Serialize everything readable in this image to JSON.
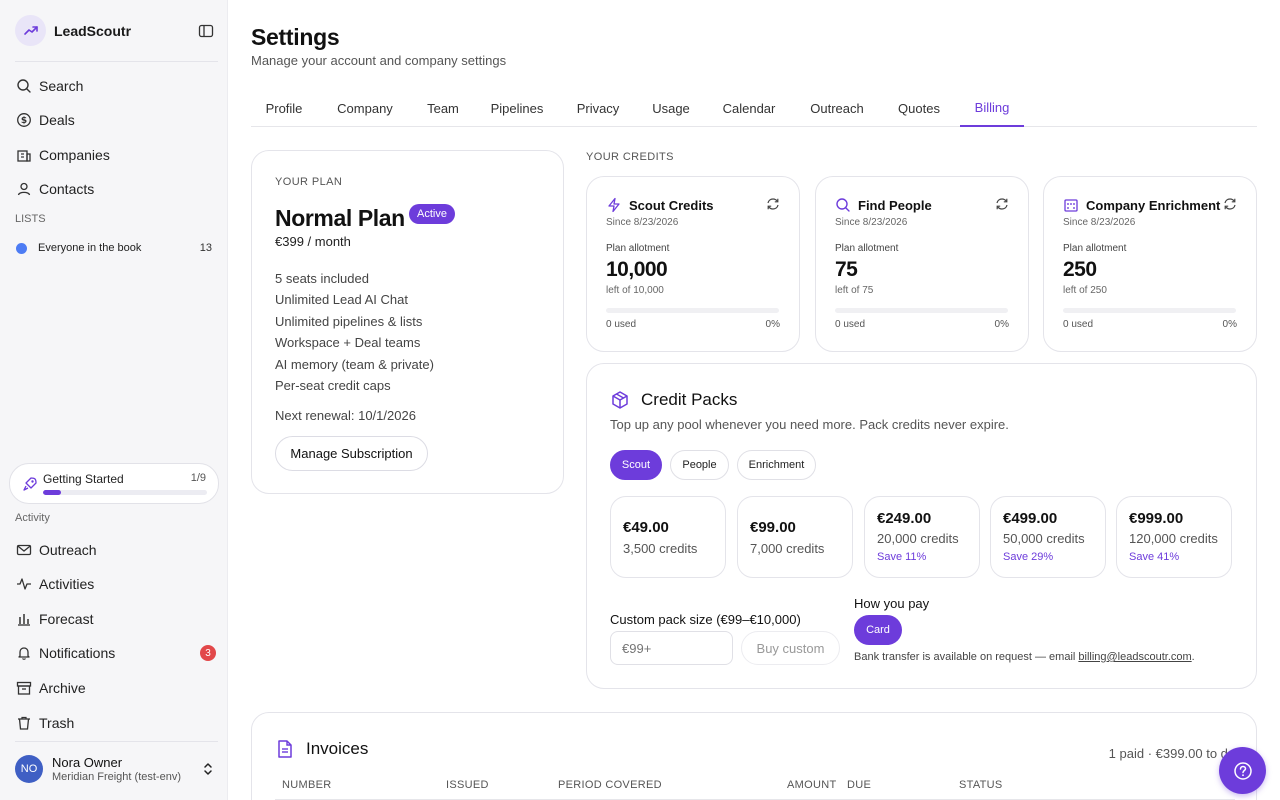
{
  "app": {
    "name": "LeadScoutr"
  },
  "sidebar": {
    "nav": [
      {
        "label": "Search",
        "icon": "search-icon"
      },
      {
        "label": "Deals",
        "icon": "dollar-icon"
      },
      {
        "label": "Companies",
        "icon": "building-icon"
      },
      {
        "label": "Contacts",
        "icon": "user-icon"
      }
    ],
    "lists_label": "LISTS",
    "lists": [
      {
        "label": "Everyone in the book",
        "count": "13",
        "color": "#4d7cf4"
      }
    ],
    "getting_started": {
      "label": "Getting Started",
      "count": "1/9",
      "progress": 0.11
    },
    "activity_label": "Activity",
    "activity": [
      {
        "label": "Outreach",
        "icon": "mail-icon"
      },
      {
        "label": "Activities",
        "icon": "pulse-icon"
      },
      {
        "label": "Forecast",
        "icon": "bar-chart-icon"
      },
      {
        "label": "Notifications",
        "icon": "bell-icon",
        "badge": "3"
      },
      {
        "label": "Archive",
        "icon": "archive-icon"
      },
      {
        "label": "Trash",
        "icon": "trash-icon"
      }
    ],
    "user": {
      "initials": "NO",
      "name": "Nora Owner",
      "org": "Meridian Freight (test-env)"
    }
  },
  "page": {
    "title": "Settings",
    "subtitle": "Manage your account and company settings"
  },
  "tabs": [
    "Profile",
    "Company",
    "Team",
    "Pipelines",
    "Privacy",
    "Usage",
    "Calendar",
    "Outreach",
    "Quotes",
    "Billing"
  ],
  "active_tab": "Billing",
  "plan": {
    "caption": "YOUR PLAN",
    "name": "Normal Plan",
    "badge": "Active",
    "price": "€399 / month",
    "features": [
      "5 seats included",
      "Unlimited Lead AI Chat",
      "Unlimited pipelines & lists",
      "Workspace + Deal teams",
      "AI memory (team & private)",
      "Per-seat credit caps"
    ],
    "renewal": "Next renewal: 10/1/2026",
    "manage_label": "Manage Subscription"
  },
  "credits": {
    "caption": "YOUR CREDITS",
    "cards": [
      {
        "title": "Scout Credits",
        "icon": "bolt-icon",
        "since": "Since 8/23/2026",
        "allot_label": "Plan allotment",
        "value": "10,000",
        "left": "left of 10,000",
        "used": "0 used",
        "pct": "0%",
        "fill": 0
      },
      {
        "title": "Find People",
        "icon": "search-icon",
        "since": "Since 8/23/2026",
        "allot_label": "Plan allotment",
        "value": "75",
        "left": "left of 75",
        "used": "0 used",
        "pct": "0%",
        "fill": 0
      },
      {
        "title": "Company Enrichment",
        "icon": "building-icon",
        "since": "Since 8/23/2026",
        "allot_label": "Plan allotment",
        "value": "250",
        "left": "left of 250",
        "used": "0 used",
        "pct": "0%",
        "fill": 0
      }
    ]
  },
  "packs": {
    "title": "Credit Packs",
    "subtitle": "Top up any pool whenever you need more. Pack credits never expire.",
    "filters": [
      "Scout",
      "People",
      "Enrichment"
    ],
    "active_filter": "Scout",
    "items": [
      {
        "price": "€49.00",
        "credits": "3,500 credits",
        "save": ""
      },
      {
        "price": "€99.00",
        "credits": "7,000 credits",
        "save": ""
      },
      {
        "price": "€249.00",
        "credits": "20,000 credits",
        "save": "Save 11%"
      },
      {
        "price": "€499.00",
        "credits": "50,000 credits",
        "save": "Save 29%"
      },
      {
        "price": "€999.00",
        "credits": "120,000 credits",
        "save": "Save 41%"
      }
    ],
    "custom_label": "Custom pack size (€99–€10,000)",
    "custom_placeholder": "€99+",
    "buy_label": "Buy custom",
    "pay_label": "How you pay",
    "pay_method": "Card",
    "bank_note": "Bank transfer is available on request — email ",
    "bank_email": "billing@leadscoutr.com",
    "bank_suffix": "."
  },
  "invoices": {
    "title": "Invoices",
    "summary": "1 paid · €399.00 to date",
    "headers": [
      "NUMBER",
      "ISSUED",
      "PERIOD COVERED",
      "AMOUNT",
      "DUE",
      "STATUS"
    ]
  },
  "colors": {
    "accent": "#6d3cdb",
    "list_dot": "#4d7cf4",
    "badge": "#e2484a"
  }
}
